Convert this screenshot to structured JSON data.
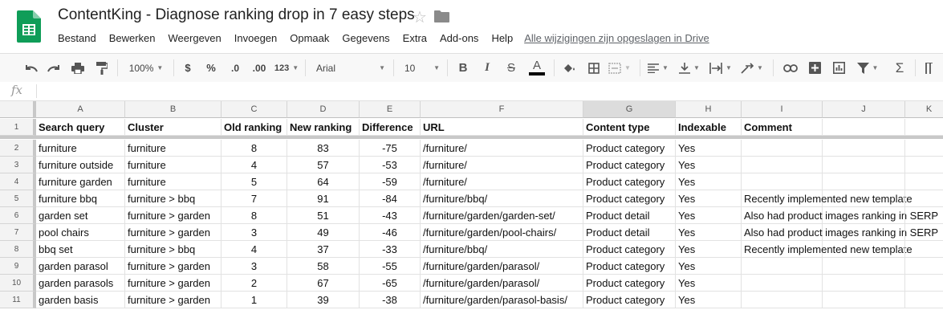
{
  "doc": {
    "title": "ContentKing - Diagnose ranking drop in 7 easy steps",
    "icons": [
      "sheets-logo-icon",
      "star-icon",
      "folder-icon"
    ]
  },
  "menu": {
    "items": [
      "Bestand",
      "Bewerken",
      "Weergeven",
      "Invoegen",
      "Opmaak",
      "Gegevens",
      "Extra",
      "Add-ons",
      "Help"
    ],
    "saved_status": "Alle wijzigingen zijn opgeslagen in Drive"
  },
  "toolbar": {
    "zoom": "100%",
    "currency": "$",
    "percent": "%",
    "dec_decrease": ".0",
    "dec_increase": ".00",
    "more_formats": "123",
    "font": "Arial",
    "font_size": "10",
    "bold": "B",
    "italic": "I",
    "strike": "S",
    "text_color": "A",
    "sum": "Σ"
  },
  "formula": {
    "fx": "fx",
    "value": ""
  },
  "sheet": {
    "columns": [
      "A",
      "B",
      "C",
      "D",
      "E",
      "F",
      "G",
      "H",
      "I",
      "J",
      "K"
    ],
    "rows": [
      [
        "Search query",
        "Cluster",
        "Old ranking",
        "New ranking",
        "Difference",
        "URL",
        "Content type",
        "Indexable",
        "Comment",
        ""
      ],
      [
        "furniture",
        "furniture",
        "8",
        "83",
        "-75",
        "/furniture/",
        "Product category",
        "Yes",
        "",
        ""
      ],
      [
        "furniture outside",
        "furniture",
        "4",
        "57",
        "-53",
        "/furniture/",
        "Product category",
        "Yes",
        "",
        ""
      ],
      [
        "furniture garden",
        "furniture",
        "5",
        "64",
        "-59",
        "/furniture/",
        "Product category",
        "Yes",
        "",
        ""
      ],
      [
        "furniture bbq",
        "furniture > bbq",
        "7",
        "91",
        "-84",
        "/furniture/bbq/",
        "Product category",
        "Yes",
        "Recently implemented new template",
        ""
      ],
      [
        "garden set",
        "furniture > garden",
        "8",
        "51",
        "-43",
        "/furniture/garden/garden-set/",
        "Product detail",
        "Yes",
        "Also had product images ranking in SERP",
        ""
      ],
      [
        "pool chairs",
        "furniture > garden",
        "3",
        "49",
        "-46",
        "/furniture/garden/pool-chairs/",
        "Product detail",
        "Yes",
        "Also had product images ranking in SERP",
        ""
      ],
      [
        "bbq set",
        "furniture > bbq",
        "4",
        "37",
        "-33",
        "/furniture/bbq/",
        "Product category",
        "Yes",
        "Recently implemented new template",
        ""
      ],
      [
        "garden parasol",
        "furniture > garden",
        "3",
        "58",
        "-55",
        "/furniture/garden/parasol/",
        "Product category",
        "Yes",
        "",
        ""
      ],
      [
        "garden parasols",
        "furniture > garden",
        "2",
        "67",
        "-65",
        "/furniture/garden/parasol/",
        "Product category",
        "Yes",
        "",
        ""
      ],
      [
        "garden basis",
        "furniture > garden",
        "1",
        "39",
        "-38",
        "/furniture/garden/parasol-basis/",
        "Product category",
        "Yes",
        "",
        ""
      ]
    ]
  }
}
